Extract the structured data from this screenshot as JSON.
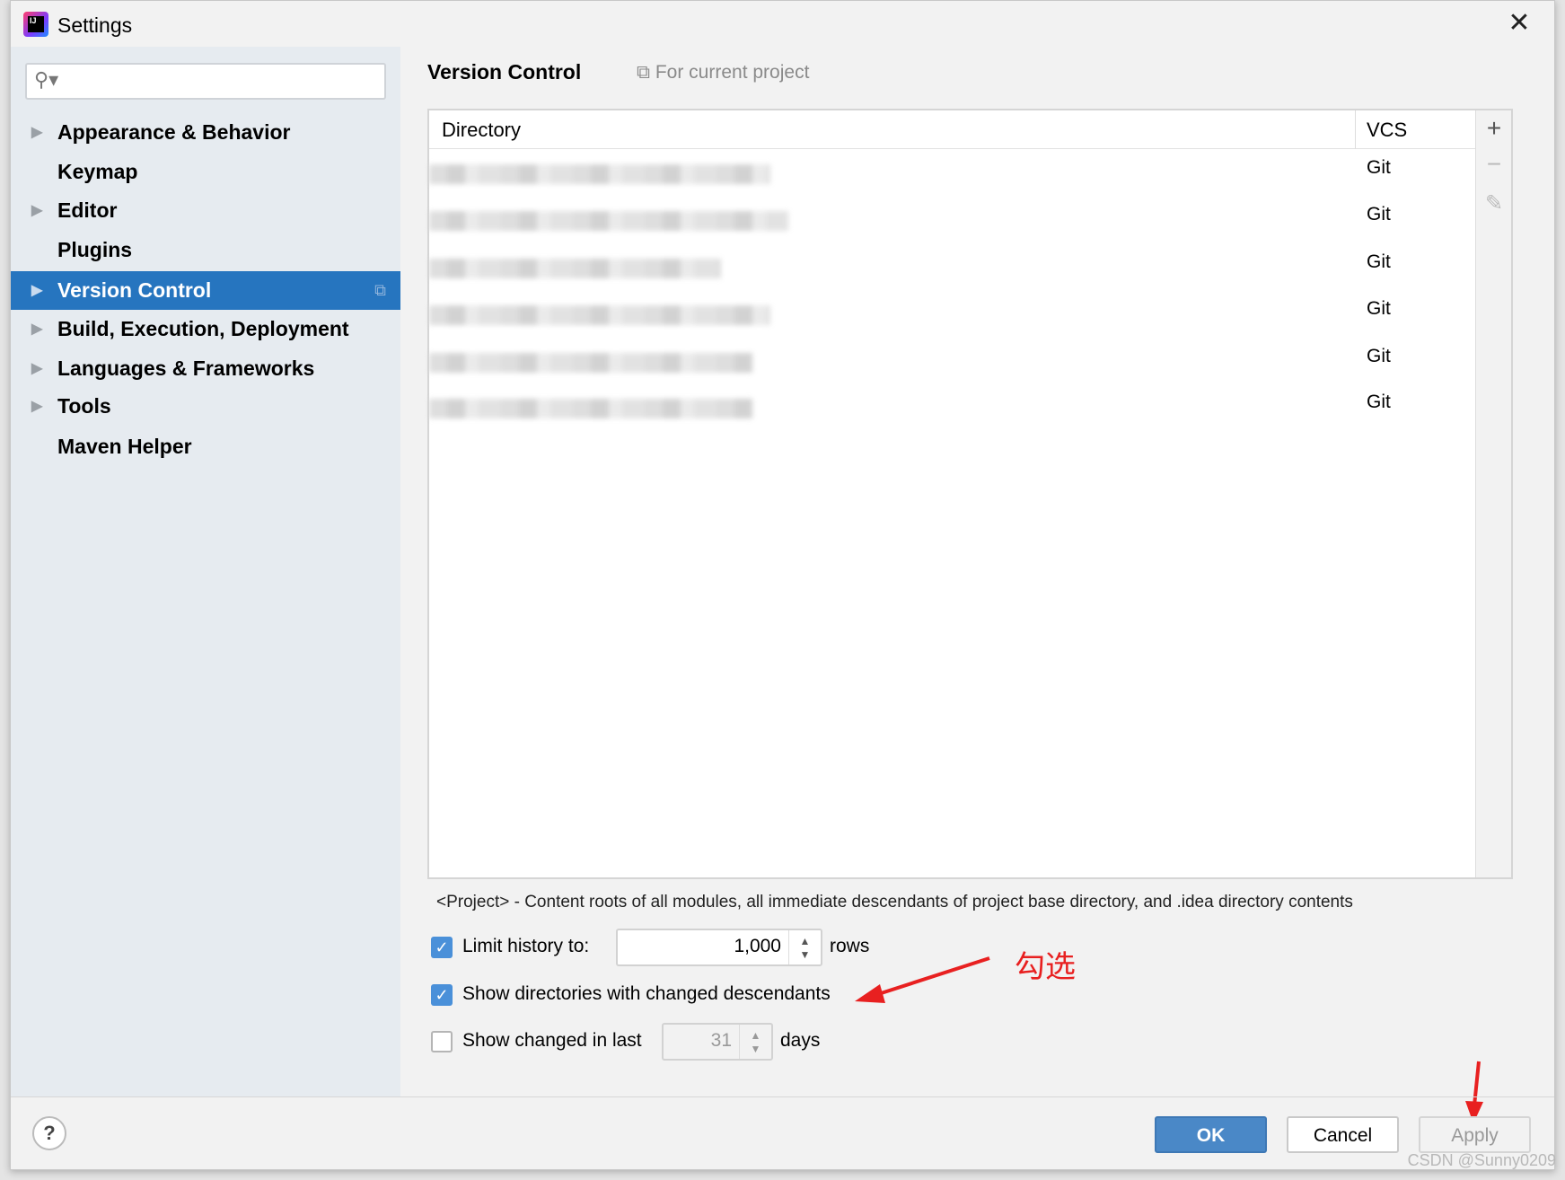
{
  "window": {
    "title": "Settings",
    "close_icon": "close-icon"
  },
  "sidebar": {
    "search_placeholder": "",
    "items": [
      {
        "label": "Appearance & Behavior",
        "expandable": true
      },
      {
        "label": "Keymap",
        "expandable": false
      },
      {
        "label": "Editor",
        "expandable": true
      },
      {
        "label": "Plugins",
        "expandable": false
      },
      {
        "label": "Version Control",
        "expandable": true,
        "selected": true
      },
      {
        "label": "Build, Execution, Deployment",
        "expandable": true
      },
      {
        "label": "Languages & Frameworks",
        "expandable": true
      },
      {
        "label": "Tools",
        "expandable": true
      },
      {
        "label": "Maven Helper",
        "expandable": false
      }
    ]
  },
  "main": {
    "title": "Version Control",
    "scope": "For current project",
    "table": {
      "columns": [
        "Directory",
        "VCS"
      ],
      "rows": [
        {
          "vcs": "Git"
        },
        {
          "vcs": "Git"
        },
        {
          "vcs": "Git"
        },
        {
          "vcs": "Git"
        },
        {
          "vcs": "Git"
        },
        {
          "vcs": "Git"
        }
      ],
      "tools": {
        "add": "+",
        "remove": "−",
        "edit": "✎"
      }
    },
    "description": "<Project> - Content roots of all modules, all immediate descendants of project base directory, and .idea directory contents",
    "limit_history": {
      "checked": true,
      "label": "Limit history to:",
      "value": "1,000",
      "unit": "rows"
    },
    "show_dirs": {
      "checked": true,
      "label": "Show directories with changed descendants"
    },
    "show_changed": {
      "checked": false,
      "label": "Show changed in last",
      "value": "31",
      "unit": "days"
    }
  },
  "annotation": {
    "text": "勾选",
    "color": "#e82020"
  },
  "footer": {
    "help": "?",
    "ok": "OK",
    "cancel": "Cancel",
    "apply": "Apply"
  },
  "watermark": "CSDN @Sunny0209",
  "colors": {
    "accent": "#2675bf",
    "ok_button": "#4a88c7"
  }
}
